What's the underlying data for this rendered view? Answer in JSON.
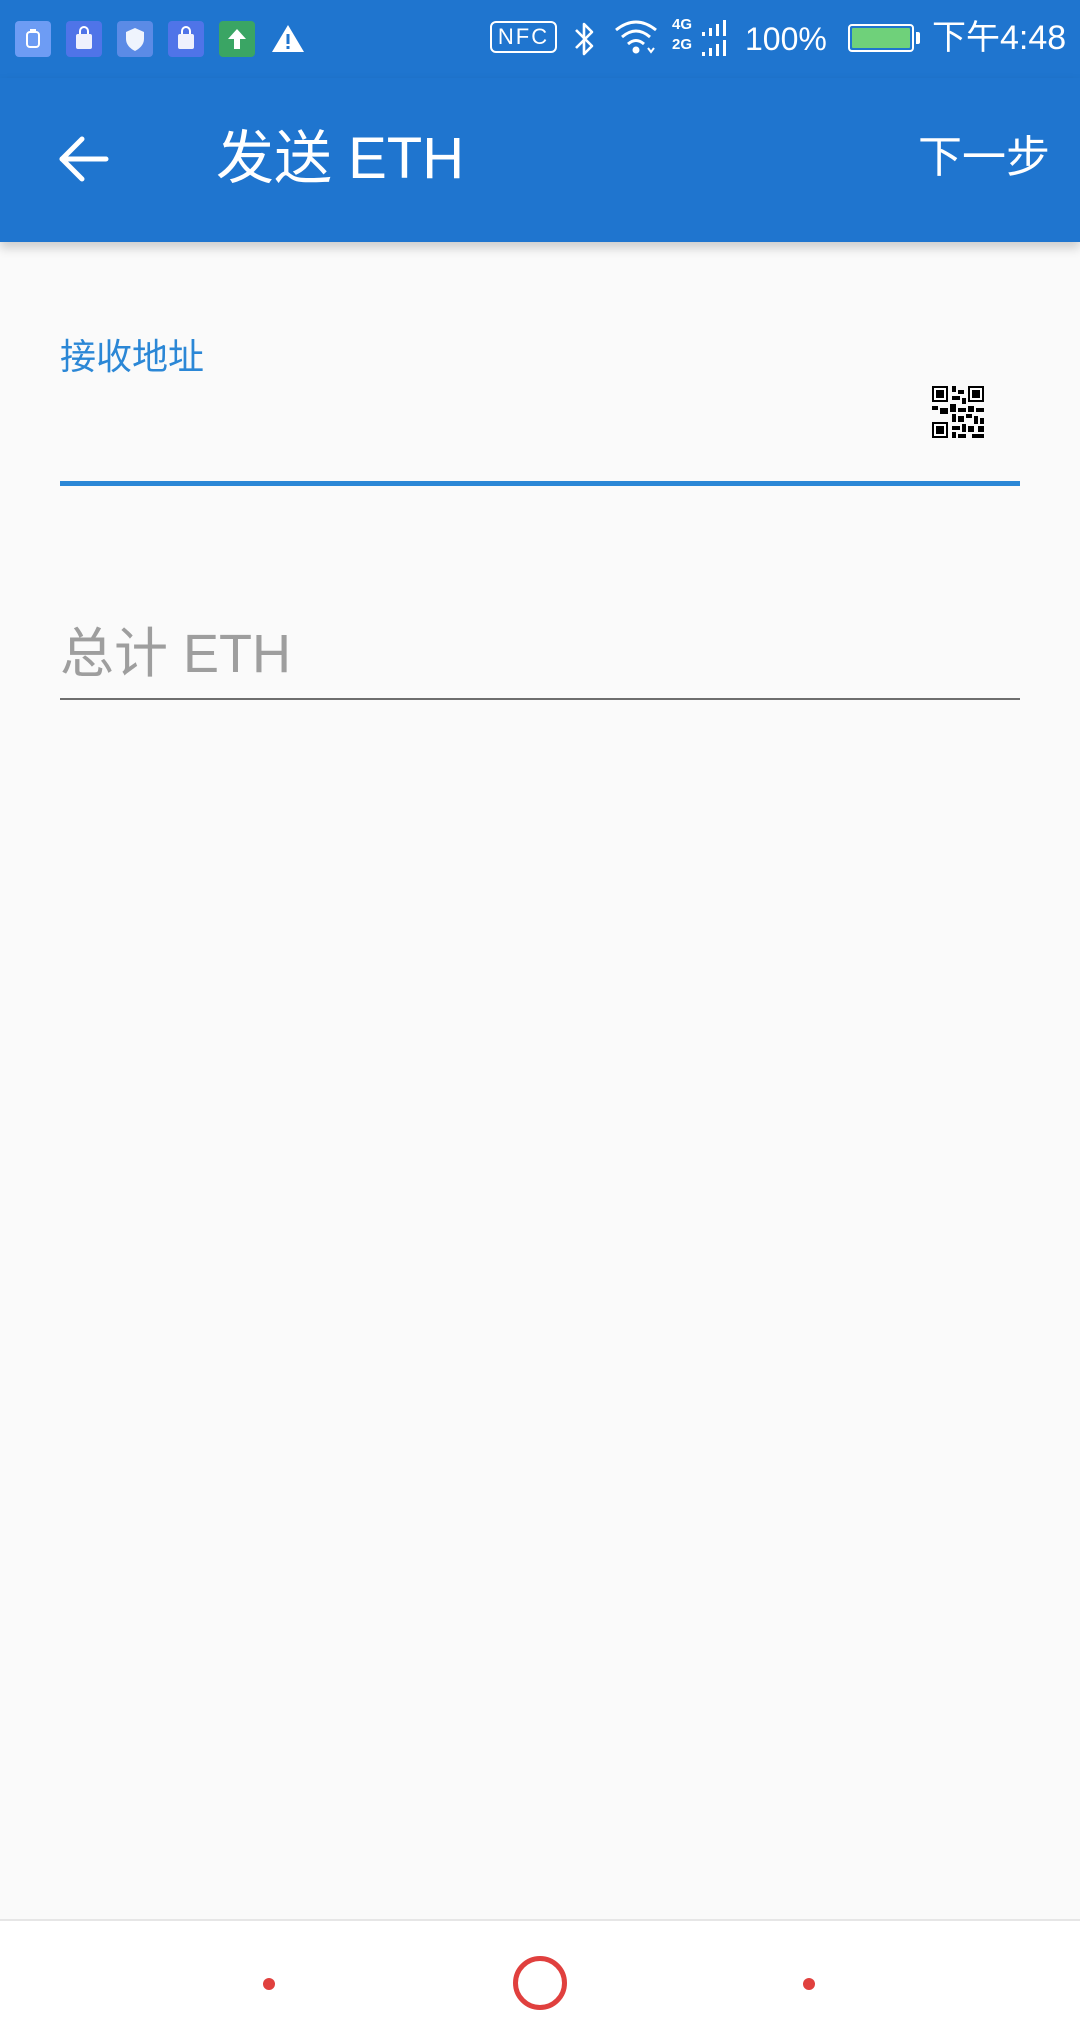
{
  "status_bar": {
    "notification_icons": [
      "usb-icon",
      "shopping-bag-icon",
      "shield-icon",
      "shopping-bag-icon",
      "upload-icon",
      "warning-icon"
    ],
    "nfc": "NFC",
    "network_top": "4G",
    "network_bottom": "2G",
    "battery": "100%",
    "battery_level": 1.0,
    "time": "下午4:48"
  },
  "app_bar": {
    "title": "发送 ETH",
    "next": "下一步",
    "back_icon": "arrow-left-icon"
  },
  "form": {
    "address_label": "接收地址",
    "address_value": "",
    "qr_icon": "qr-code-icon",
    "amount_placeholder": "总计 ETH",
    "amount_value": ""
  },
  "nav_bar": {
    "buttons": [
      "back-dot",
      "home-circle",
      "recents-dot"
    ]
  },
  "colors": {
    "primary": "#1f75cf",
    "accent": "#2b87d6",
    "background": "#fafafa",
    "nav_accent": "#e0403e"
  }
}
